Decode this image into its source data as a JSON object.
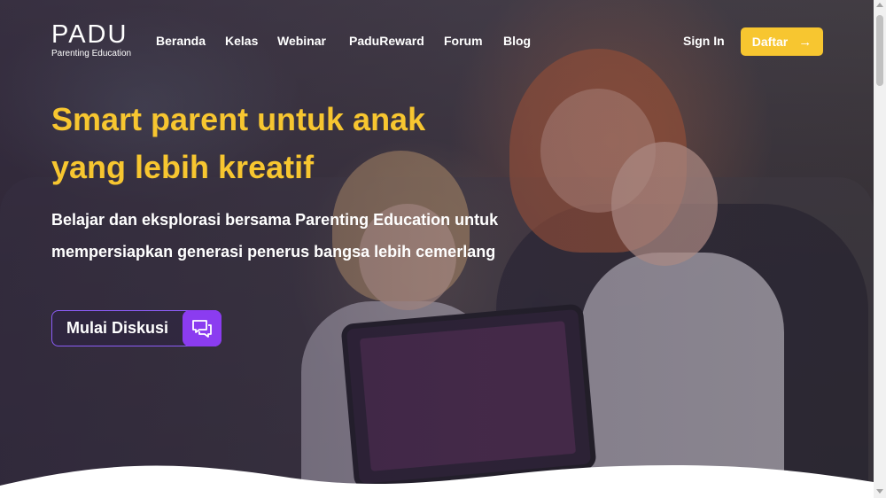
{
  "brand": {
    "logo_text": "PADU",
    "tagline": "Parenting Education"
  },
  "nav": {
    "items": [
      {
        "label": "Beranda"
      },
      {
        "label": "Kelas"
      },
      {
        "label": "Webinar"
      },
      {
        "label": "PaduReward"
      },
      {
        "label": "Forum"
      },
      {
        "label": "Blog"
      }
    ],
    "sign_in": "Sign In",
    "register": "Daftar"
  },
  "hero": {
    "headline_line1": "Smart parent untuk anak",
    "headline_line2": "yang lebih kreatif",
    "description": "Belajar dan eksplorasi bersama Parenting Education untuk mempersiapkan generasi penerus bangsa lebih cemerlang",
    "cta_label": "Mulai Diskusi"
  },
  "icons": {
    "register_arrow": "arrow-right-icon",
    "cta_icon": "chat-bubbles-icon"
  },
  "colors": {
    "accent_yellow": "#f7c630",
    "accent_purple": "#8b3cf0"
  }
}
